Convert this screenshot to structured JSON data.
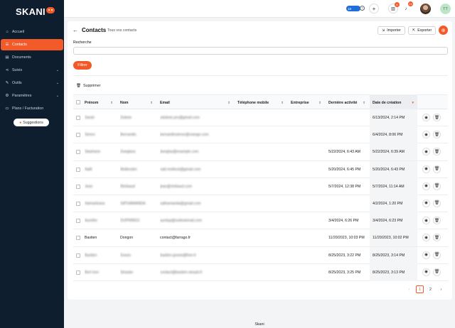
{
  "brand": {
    "name": "SKANI"
  },
  "sidebar": {
    "items": [
      {
        "label": "Accueil",
        "icon": "home-icon",
        "glyph": "⌂",
        "expandable": false,
        "active": false
      },
      {
        "label": "Contacts",
        "icon": "list-icon",
        "glyph": "☰",
        "expandable": false,
        "active": true
      },
      {
        "label": "Documents",
        "icon": "document-icon",
        "glyph": "▤",
        "expandable": false,
        "active": false
      },
      {
        "label": "Suivis",
        "icon": "share-icon",
        "glyph": "⋖",
        "expandable": true,
        "active": false
      },
      {
        "label": "Outils",
        "icon": "wrench-icon",
        "glyph": "✎",
        "expandable": true,
        "active": false
      },
      {
        "label": "Paramètres",
        "icon": "gear-icon",
        "glyph": "⚙",
        "expandable": true,
        "active": false
      },
      {
        "label": "Plans / Facturation",
        "icon": "card-icon",
        "glyph": "▭",
        "expandable": false,
        "active": false
      }
    ],
    "suggestions_label": "Suggestions"
  },
  "header": {
    "pill_value": "18",
    "badge_1": "6",
    "badge_2": "24",
    "avatar_initials": "TT"
  },
  "page": {
    "title": "Contacts",
    "subtitle": "Tous vos contacts",
    "import_label": "Importer",
    "export_label": "Exporter",
    "search_label": "Recherche",
    "search_value": "",
    "filter_label": "Filtrer",
    "delete_label": "Supprimer"
  },
  "table": {
    "columns": [
      "Prénom",
      "Nom",
      "Email",
      "Téléphone mobile",
      "Entreprise",
      "Dernière activité",
      "Date de création"
    ],
    "rows": [
      {
        "prenom": "Sarah",
        "nom": "Dubois",
        "email": "sdubois.pro@gmail.com",
        "tel": "",
        "entreprise": "",
        "derniere": "",
        "creation": "6/13/2024, 2:14 PM",
        "blur": true
      },
      {
        "prenom": "Simon",
        "nom": "Bernardin",
        "email": "bernardinsimon@orange.com",
        "tel": "",
        "entreprise": "",
        "derniere": "",
        "creation": "6/4/2024, 8:06 PM",
        "blur": true
      },
      {
        "prenom": "Stephane",
        "nom": "Doeglass",
        "email": "doeglas@example.com",
        "tel": "",
        "entreprise": "",
        "derniere": "5/22/2024, 6:43 AM",
        "creation": "5/22/2024, 6:39 AM",
        "blur": true
      },
      {
        "prenom": "Nallt",
        "nom": "Mollerstim",
        "email": "natt.mollerst@gmail.com",
        "tel": "",
        "entreprise": "",
        "derniere": "5/20/2024, 6:45 PM",
        "creation": "5/20/2024, 6:43 PM",
        "blur": true
      },
      {
        "prenom": "Jean",
        "nom": "Rimbaud",
        "email": "jean@rimbaud.com",
        "tel": "",
        "entreprise": "",
        "derniere": "5/7/2024, 12:38 PM",
        "creation": "5/7/2024, 11:14 AM",
        "blur": true
      },
      {
        "prenom": "Hamantrasa",
        "nom": "SATHAMANDA",
        "email": "sathamanda@gmail.com",
        "tel": "",
        "entreprise": "",
        "derniere": "",
        "creation": "4/2/2024, 1:20 PM",
        "blur": true
      },
      {
        "prenom": "Aurelhe",
        "nom": "DUPRIREG",
        "email": "aurdup@outlookmail.com",
        "tel": "",
        "entreprise": "",
        "derniere": "3/4/2024, 6:26 PM",
        "creation": "3/4/2024, 6:23 PM",
        "blur": true
      },
      {
        "prenom": "Bastien",
        "nom": "Dongon",
        "email": "contact@farrago.fr",
        "tel": "",
        "entreprise": "",
        "derniere": "11/20/2023, 10:03 PM",
        "creation": "11/20/2023, 10:02 PM",
        "blur": false
      },
      {
        "prenom": "Bastien",
        "nom": "Gravis",
        "email": "bastien.gravis@free.fr",
        "tel": "",
        "entreprise": "",
        "derniere": "8/25/2023, 3:22 PM",
        "creation": "8/25/2023, 3:14 PM",
        "blur": true
      },
      {
        "prenom": "Bert Inre",
        "nom": "Straube",
        "email": "contact@bastien-straub.fr",
        "tel": "",
        "entreprise": "",
        "derniere": "8/25/2023, 3:25 PM",
        "creation": "8/25/2023, 3:13 PM",
        "blur": true
      }
    ]
  },
  "pagination": {
    "prev": "‹",
    "pages": [
      "1",
      "2"
    ],
    "current": "1",
    "next": "›"
  },
  "footer": {
    "text": "Skani"
  },
  "colors": {
    "accent": "#f25a2a",
    "sidebar": "#0f1e2e",
    "pill": "#1e6fd9"
  }
}
